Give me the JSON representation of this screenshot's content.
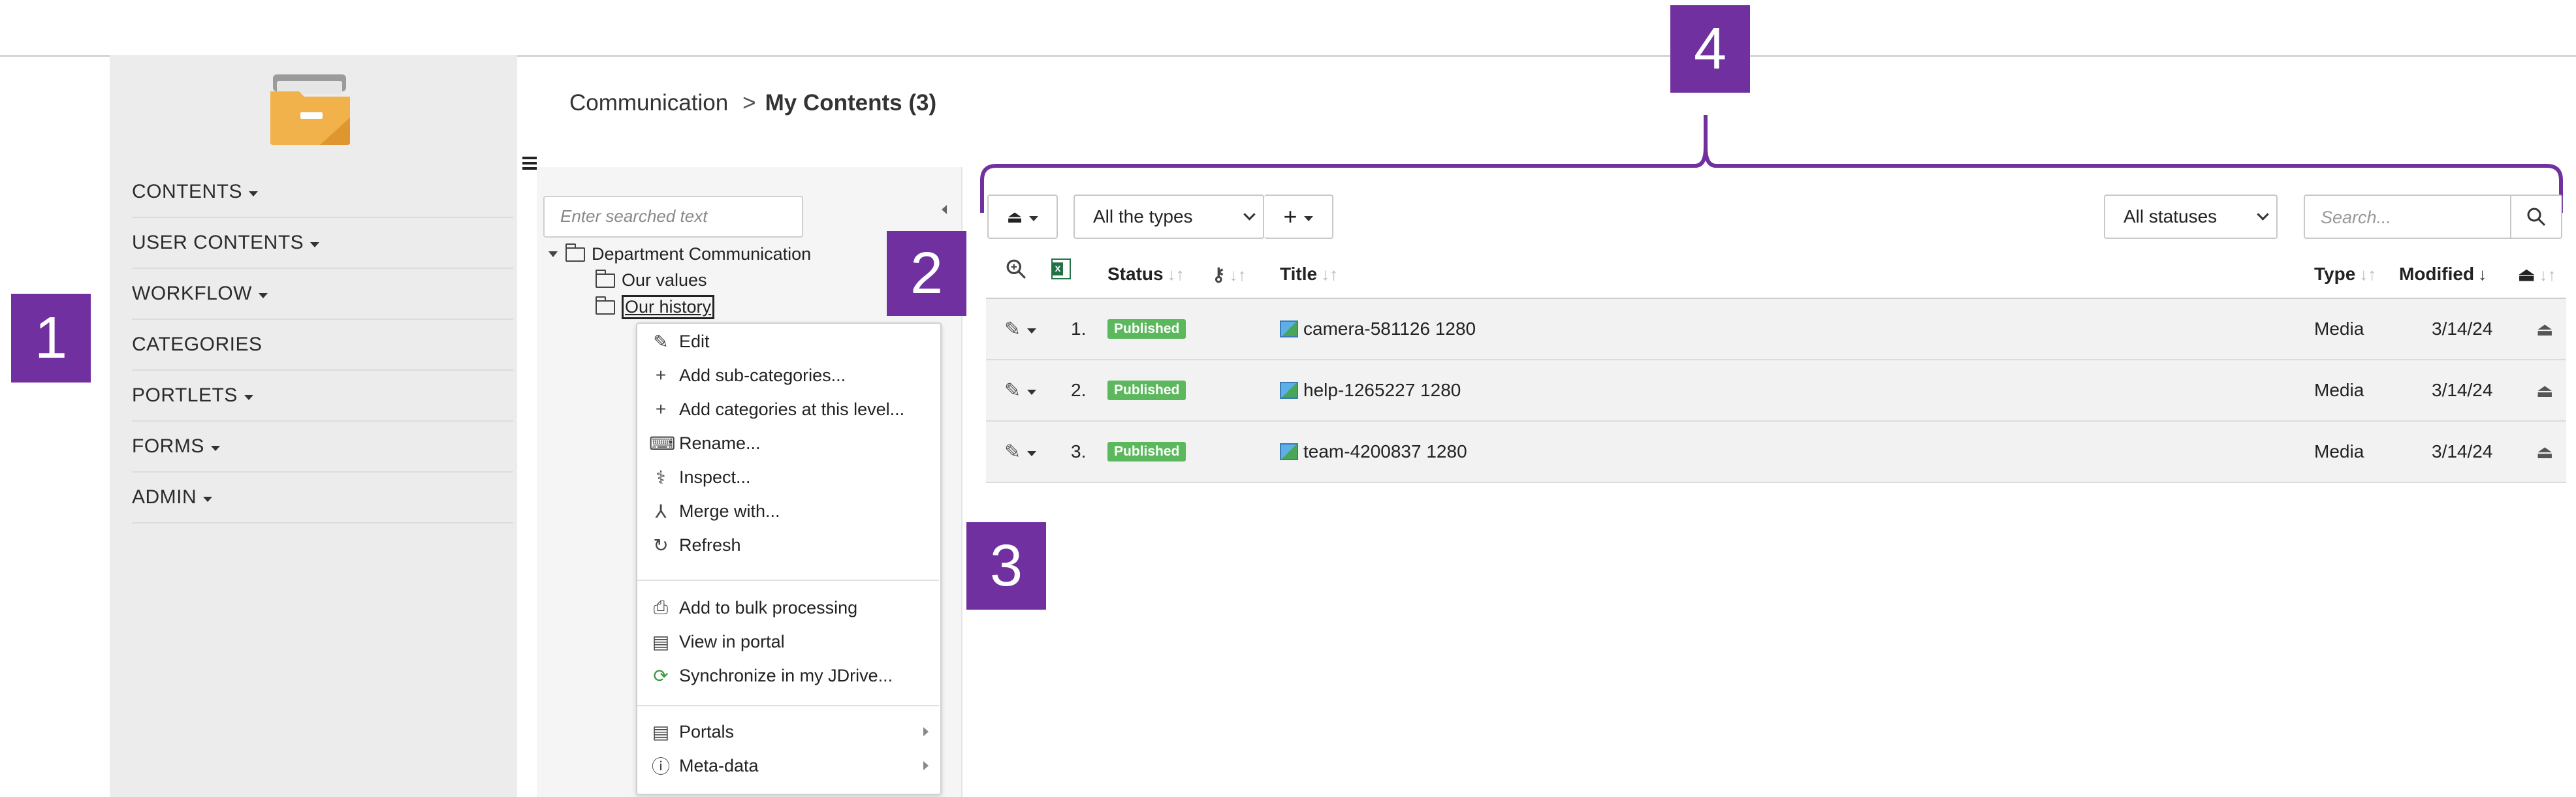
{
  "callouts": [
    "1",
    "2",
    "3",
    "4"
  ],
  "sidebar": {
    "items": [
      {
        "label": "CONTENTS",
        "has_caret": true
      },
      {
        "label": "USER CONTENTS",
        "has_caret": true
      },
      {
        "label": "WORKFLOW",
        "has_caret": true
      },
      {
        "label": "CATEGORIES",
        "has_caret": false
      },
      {
        "label": "PORTLETS",
        "has_caret": true
      },
      {
        "label": "FORMS",
        "has_caret": true
      },
      {
        "label": "ADMIN",
        "has_caret": true
      }
    ]
  },
  "breadcrumb": {
    "parent": "Communication",
    "separator": ">",
    "current": "My Contents (3)"
  },
  "tree": {
    "search_placeholder": "Enter searched text",
    "root": "Department Communication",
    "children": [
      "Our values",
      "Our history"
    ]
  },
  "context_menu": {
    "groups": [
      [
        {
          "label": "Edit",
          "icon": "pencil-icon"
        },
        {
          "label": "Add sub-categories...",
          "icon": "plus-icon"
        },
        {
          "label": "Add categories at this level...",
          "icon": "plus-icon"
        },
        {
          "label": "Rename...",
          "icon": "keyboard-icon"
        },
        {
          "label": "Inspect...",
          "icon": "stethoscope-icon"
        },
        {
          "label": "Merge with...",
          "icon": "merge-icon"
        },
        {
          "label": "Refresh",
          "icon": "refresh-icon"
        }
      ],
      [
        {
          "label": "Add to bulk processing",
          "icon": "inbox-icon"
        },
        {
          "label": "View in portal",
          "icon": "portal-icon"
        },
        {
          "label": "Synchronize in my JDrive...",
          "icon": "sync-icon"
        }
      ],
      [
        {
          "label": "Portals",
          "icon": "portal-icon",
          "submenu": true
        },
        {
          "label": "Meta-data",
          "icon": "info-icon",
          "submenu": true
        }
      ]
    ]
  },
  "toolbar": {
    "type_select": "All the types",
    "status_select": "All statuses",
    "search_placeholder": "Search..."
  },
  "table": {
    "headers": {
      "status": "Status",
      "title": "Title",
      "type": "Type",
      "modified": "Modified"
    },
    "rows": [
      {
        "num": "1.",
        "status": "Published",
        "title": "camera-581126 1280",
        "type": "Media",
        "modified": "3/14/24"
      },
      {
        "num": "2.",
        "status": "Published",
        "title": "help-1265227 1280",
        "type": "Media",
        "modified": "3/14/24"
      },
      {
        "num": "3.",
        "status": "Published",
        "title": "team-4200837 1280",
        "type": "Media",
        "modified": "3/14/24"
      }
    ]
  },
  "colors": {
    "callout": "#7030a0",
    "published": "#5cb85c",
    "folder_logo": "#f2b24b"
  }
}
